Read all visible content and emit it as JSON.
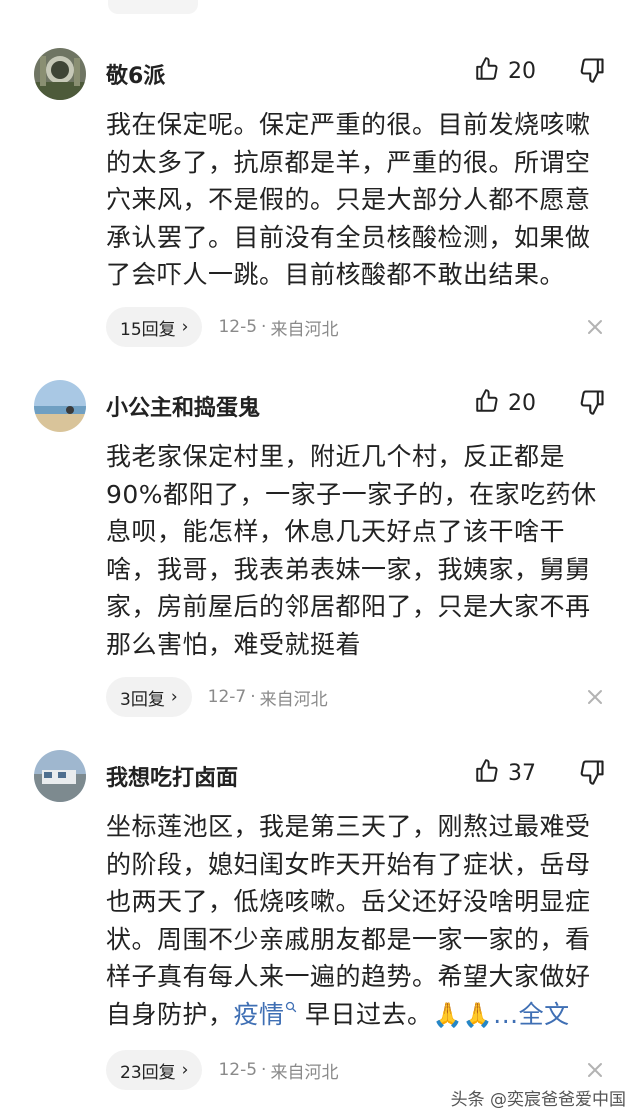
{
  "comments": [
    {
      "username": "敬6派",
      "likes": "20",
      "lines": [
        "我在保定呢。保定严重的很。目前发烧咳嗽",
        "的太多了，抗原都是羊，严重的很。所谓空",
        "穴来风，不是假的。只是大部分人都不愿意",
        "承认罢了。目前没有全员核酸检测，如果做",
        "了会吓人一跳。目前核酸都不敢出结果。"
      ],
      "reply_label": "15回复",
      "date": "12-5",
      "location": "来自河北"
    },
    {
      "username": "小公主和捣蛋鬼",
      "likes": "20",
      "lines": [
        "我老家保定村里，附近几个村，反正都是",
        "90%都阳了，一家子一家子的，在家吃药休",
        "息呗，能怎样，休息几天好点了该干啥干",
        "啥，我哥，我表弟表妹一家，我姨家，舅舅",
        "家，房前屋后的邻居都阳了，只是大家不再",
        "那么害怕，难受就挺着"
      ],
      "reply_label": "3回复",
      "date": "12-7",
      "location": "来自河北"
    },
    {
      "username": "我想吃打卤面",
      "likes": "37",
      "lines": [
        "坐标莲池区，我是第三天了，刚熬过最难受",
        "的阶段，媳妇闺女昨天开始有了症状，岳母",
        "也两天了，低烧咳嗽。岳父还好没啥明显症",
        "状。周围不少亲戚朋友都是一家一家的，看",
        "样子真有每人来一遍的趋势。希望大家做好"
      ],
      "last_line_prefix": "自身防护，",
      "tag": "疫情",
      "last_line_suffix": " 早日过去。",
      "emoji": "🙏🙏",
      "more_label": "...全文",
      "reply_label": "23回复",
      "date": "12-5",
      "location": "来自河北"
    }
  ],
  "separator": "·",
  "watermark": "头条 @奕宸爸爸爱中国",
  "icons": [
    "thumbs-up-icon",
    "thumbs-down-icon",
    "close-icon",
    "chevron-right-icon",
    "search-icon"
  ],
  "colors": {
    "link": "#3f6fb4",
    "meta": "#8a8a8a",
    "pill": "#f2f2f2"
  }
}
